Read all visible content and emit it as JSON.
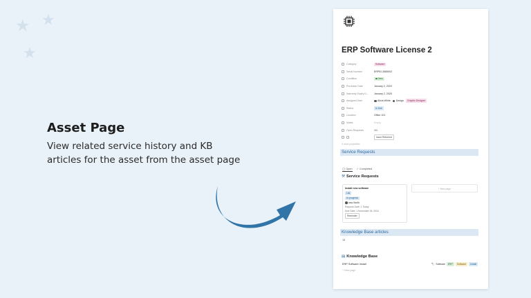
{
  "promo": {
    "heading": "Asset Page",
    "line1": "View related service history and KB",
    "line2": "articles for the asset from the asset page"
  },
  "page": {
    "icon": "chip-icon",
    "title": "ERP Software License 2",
    "properties": [
      {
        "key": "Category",
        "value": "Software",
        "tag": "pink"
      },
      {
        "key": "Serial Number",
        "value": "ERPID-3585002"
      },
      {
        "key": "Condition",
        "value": "New",
        "tag": "green"
      },
      {
        "key": "Purchase Date",
        "value": "January 2, 2024"
      },
      {
        "key": "Warranty Expiry D...",
        "value": "January 2, 2025"
      },
      {
        "key": "Assigned User",
        "value": "Alicia White",
        "extra1": "Design",
        "extra2": "Graphic Designer"
      },
      {
        "key": "Status",
        "value": "In Use",
        "tag": "blue"
      },
      {
        "key": "Location",
        "value": "Office 101"
      },
      {
        "key": "Notes",
        "value": "Empty",
        "muted": true
      },
      {
        "key": "Open Requests",
        "value": "1/1"
      },
      {
        "key": "",
        "value": "Issue Returned",
        "tag": "outline"
      }
    ],
    "more_label": "4 more properties"
  },
  "service": {
    "section_label": "Service Requests",
    "tab_open": "Open",
    "tab_completed": "Completed",
    "db_title": "Service Requests",
    "card": {
      "title": "Install new software",
      "tag1": "List",
      "tag2": "In progress",
      "person": "new Smith",
      "request_date": "Request Date: 1 Today",
      "due_date": "Due Date: 1 November 05, 2024",
      "button": "Reminder"
    },
    "new_page": "+ New page"
  },
  "kb": {
    "section_label": "Knowledge Base articles",
    "count": "18",
    "db_title": "Knowledge Base",
    "row_title": "ERP Software Install",
    "row_tag_label": "Software",
    "tags": [
      "ERP",
      "Software",
      "Install"
    ],
    "new_page": "+ New page"
  },
  "colors": {
    "background": "#e9f2f9",
    "accent": "#2f6aa3",
    "arrow": "#3174a8"
  }
}
